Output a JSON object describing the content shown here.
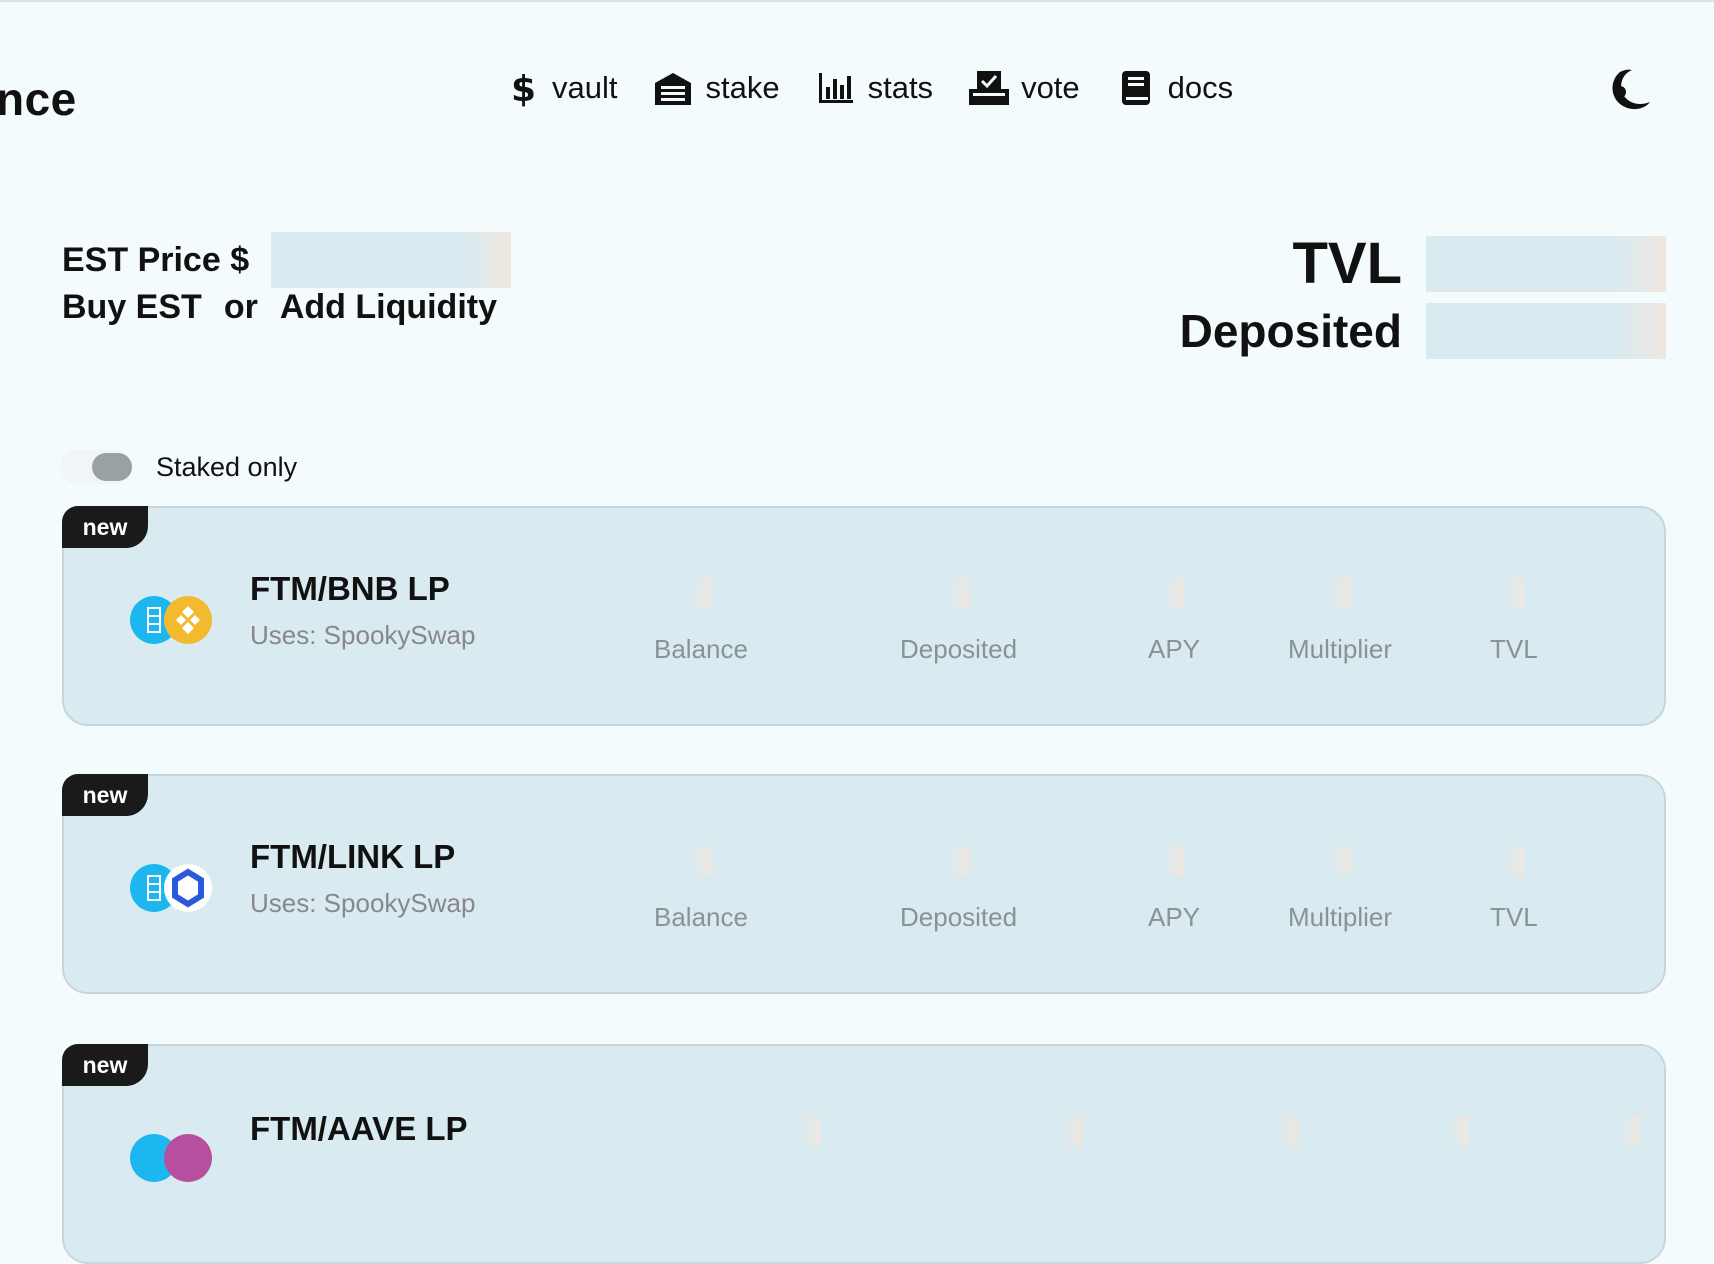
{
  "brand": {
    "title": "nce"
  },
  "nav": [
    {
      "label": "vault",
      "icon": "dollar-icon"
    },
    {
      "label": "stake",
      "icon": "warehouse-icon"
    },
    {
      "label": "stats",
      "icon": "bar-chart-icon"
    },
    {
      "label": "vote",
      "icon": "ballot-box-icon"
    },
    {
      "label": "docs",
      "icon": "book-icon"
    }
  ],
  "theme_toggle_icon": "moon-icon",
  "price": {
    "label": "EST Price $",
    "buy_label": "Buy EST",
    "or_label": "or",
    "liquidity_label": "Add Liquidity"
  },
  "totals": {
    "tvl_label": "TVL",
    "deposited_label": "Deposited"
  },
  "filter": {
    "staked_only_label": "Staked only"
  },
  "pools": [
    {
      "badge": "new",
      "name": "FTM/BNB LP",
      "uses": "Uses: SpookySwap",
      "token_icons": [
        "fantom-icon",
        "bnb-icon"
      ],
      "stats": [
        "Balance",
        "Deposited",
        "APY",
        "Multiplier",
        "TVL"
      ]
    },
    {
      "badge": "new",
      "name": "FTM/LINK LP",
      "uses": "Uses: SpookySwap",
      "token_icons": [
        "fantom-icon",
        "chainlink-icon"
      ],
      "stats": [
        "Balance",
        "Deposited",
        "APY",
        "Multiplier",
        "TVL"
      ]
    },
    {
      "badge": "new",
      "name": "FTM/AAVE LP",
      "uses": "",
      "token_icons": [
        "fantom-icon",
        "aave-icon"
      ],
      "stats": []
    }
  ],
  "colors": {
    "background": "#f3fbfd",
    "card": "#d9ebf1",
    "badge": "#1a1a1a",
    "fantom": "#1db7f0",
    "bnb": "#f3ba2f",
    "chainlink": "#2a5ada",
    "aave": "#b6509e"
  }
}
